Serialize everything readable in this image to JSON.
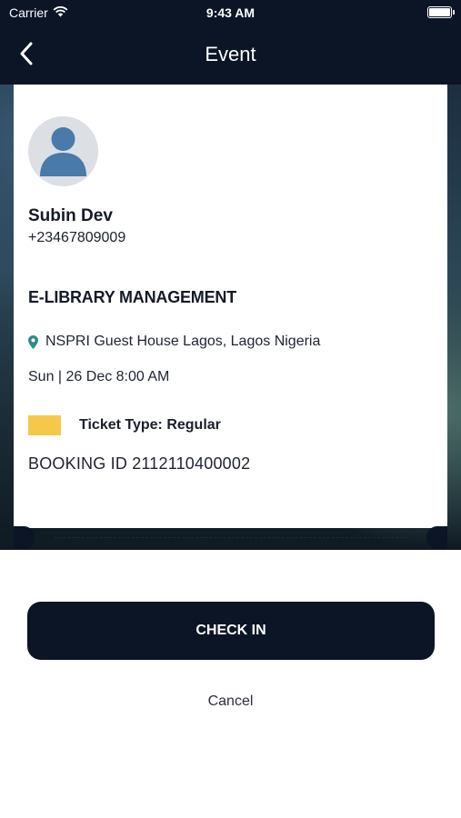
{
  "status_bar": {
    "carrier": "Carrier",
    "time": "9:43 AM"
  },
  "nav": {
    "title": "Event"
  },
  "user": {
    "name": "Subin Dev",
    "phone": "+23467809009"
  },
  "event": {
    "title": "E-LIBRARY MANAGEMENT",
    "location": "NSPRI Guest House Lagos, Lagos Nigeria",
    "date": "Sun | 26 Dec 8:00 AM",
    "ticket_type": "Ticket Type: Regular",
    "ticket_color": "#f5c84a",
    "booking_id": "BOOKING ID 2112110400002"
  },
  "actions": {
    "check_in": "CHECK IN",
    "cancel": "Cancel"
  },
  "colors": {
    "primary": "#0b1526",
    "pin": "#2e8b86"
  }
}
